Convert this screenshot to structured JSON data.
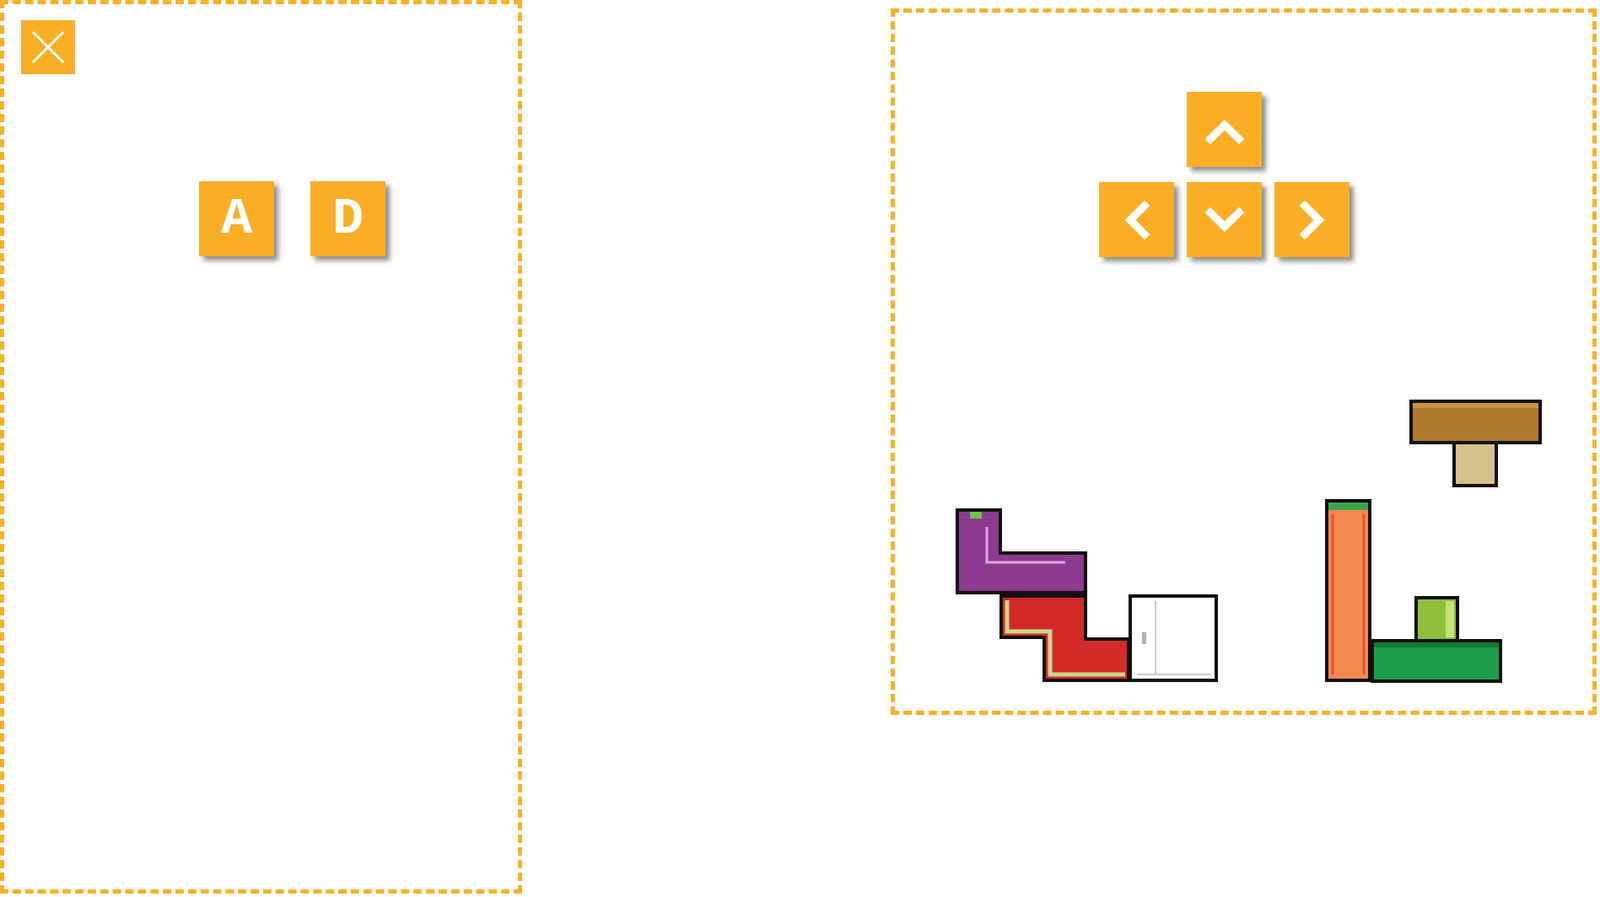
{
  "keys": [
    {
      "label": "A"
    },
    {
      "label": "D"
    }
  ]
}
